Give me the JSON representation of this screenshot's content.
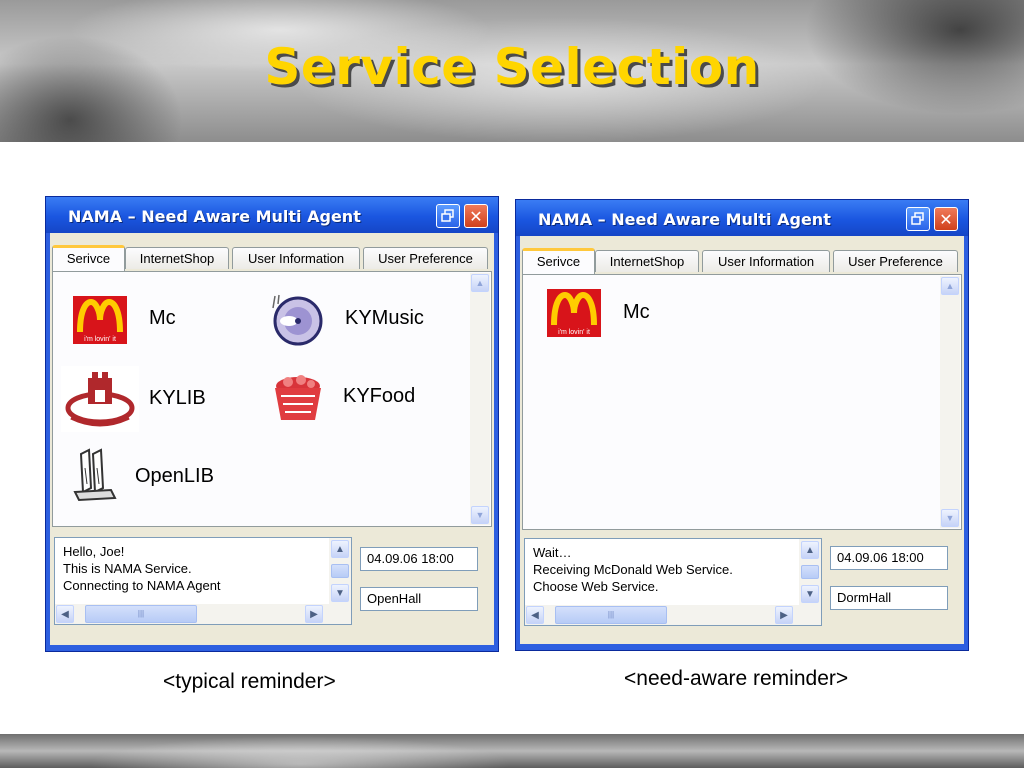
{
  "slide": {
    "title": "Service Selection"
  },
  "captions": {
    "left": "<typical reminder>",
    "right": "<need-aware reminder>"
  },
  "windows": {
    "left": {
      "title": "NAMA – Need Aware Multi Agent",
      "restore_icon": "restore-icon",
      "close_label": "✕",
      "tabs": [
        "Serivce",
        "InternetShop",
        "User Information",
        "User Preference"
      ],
      "active_tab": "Serivce",
      "services": [
        {
          "label": "Mc",
          "icon": "mcdonalds-logo-icon"
        },
        {
          "label": "KYMusic",
          "icon": "music-disc-icon"
        },
        {
          "label": "KYLIB",
          "icon": "library-emblem-icon"
        },
        {
          "label": "KYFood",
          "icon": "food-basket-icon"
        },
        {
          "label": "OpenLIB",
          "icon": "book-stand-icon"
        }
      ],
      "messages": [
        "Hello, Joe!",
        "This is NAMA Service.",
        "Connecting to NAMA Agent"
      ],
      "datetime": "04.09.06 18:00",
      "location": "OpenHall",
      "hscroll_grip": "|||"
    },
    "right": {
      "title": "NAMA – Need Aware Multi Agent",
      "restore_icon": "restore-icon",
      "close_label": "✕",
      "tabs": [
        "Serivce",
        "InternetShop",
        "User Information",
        "User Preference"
      ],
      "active_tab": "Serivce",
      "services": [
        {
          "label": "Mc",
          "icon": "mcdonalds-logo-icon"
        }
      ],
      "messages": [
        "Wait…",
        "Receiving McDonald Web Service.",
        "Choose Web Service."
      ],
      "datetime": "04.09.06 18:00",
      "location": "DormHall",
      "hscroll_grip": "|||"
    }
  },
  "logo_text": {
    "mcdonalds_slogan": "i'm lovin' it"
  },
  "colors": {
    "title": "#ffd500",
    "titlebar": "#1a56e0",
    "window_body": "#ece9d8",
    "active_tab_accent": "#ffc83c"
  }
}
